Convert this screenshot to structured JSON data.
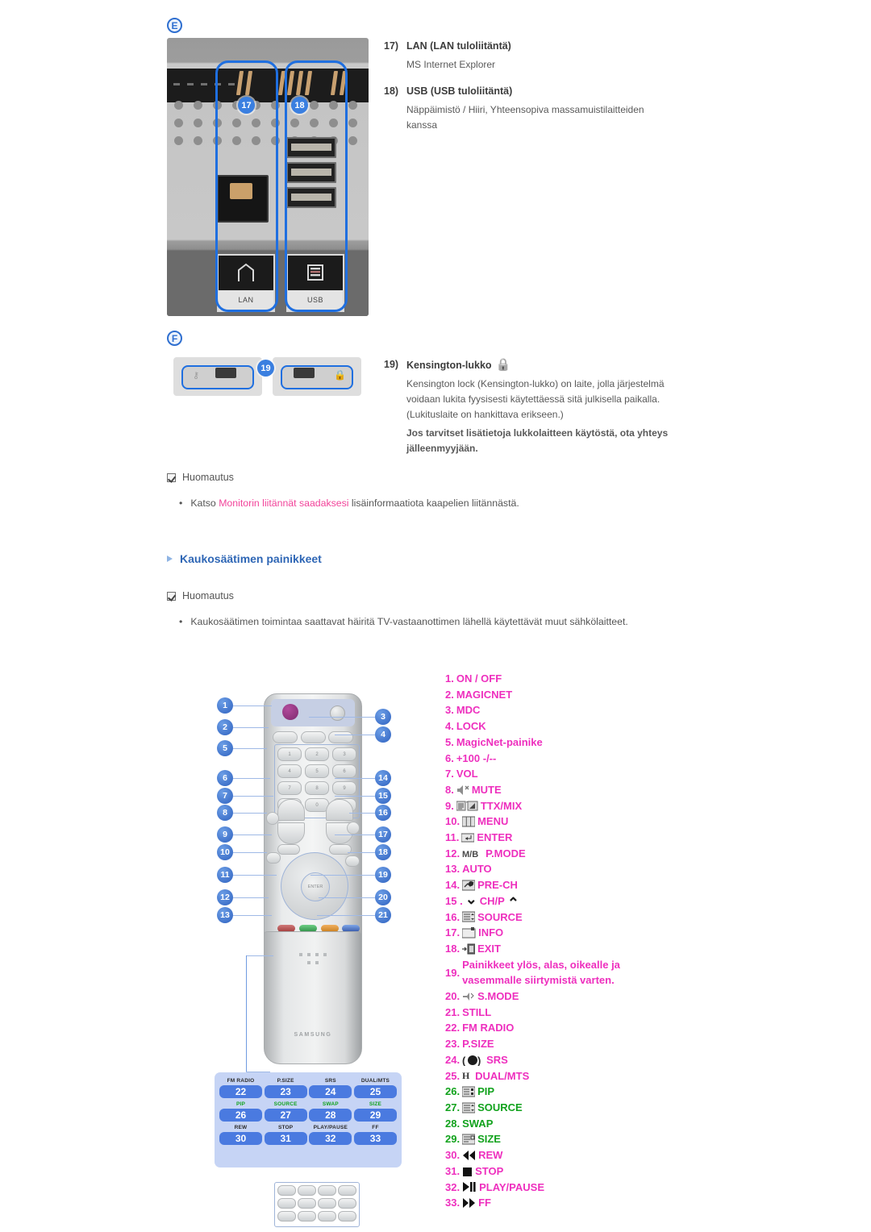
{
  "sections": {
    "E": {
      "badge": "E",
      "photo_labels": {
        "lan": "LAN",
        "usb": "USB"
      },
      "callouts": [
        "17",
        "18"
      ]
    },
    "F": {
      "badge": "F",
      "callouts": [
        "19"
      ]
    }
  },
  "connectors": [
    {
      "num": "17)",
      "title": "LAN (LAN tuloliitäntä)",
      "desc": "MS Internet Explorer"
    },
    {
      "num": "18)",
      "title": "USB (USB tuloliitäntä)",
      "desc": "Näppäimistö / Hiiri, Yhteensopiva massamuistilaitteiden kanssa"
    },
    {
      "num": "19)",
      "title": "Kensington-lukko",
      "icon": "padlock-icon",
      "desc": "Kensington lock (Kensington-lukko) on laite, jolla järjestelmä voidaan lukita fyysisesti käytettäessä sitä julkisella paikalla. (Lukituslaite on hankittava erikseen.)",
      "desc_bold": "Jos tarvitset lisätietoja lukkolaitteen käytöstä, ota yhteys jälleenmyyjään."
    }
  ],
  "notes": [
    {
      "head": "Huomautus",
      "bullet_pre": "Katso ",
      "bullet_link": "Monitorin liitännät saadaksesi",
      "bullet_post": " lisäinformaatiota kaapelien liitännästä."
    },
    {
      "head": "Huomautus",
      "bullet_pre": "Kaukosäätimen toimintaa saattavat häiritä TV-vastaanottimen lähellä käytettävät muut sähkölaitteet.",
      "bullet_link": "",
      "bullet_post": ""
    }
  ],
  "remote_heading": "Kaukosäätimen painikkeet",
  "remote_callouts_left": [
    "1",
    "2",
    "5",
    "6",
    "7",
    "8",
    "9",
    "10",
    "11",
    "12",
    "13"
  ],
  "remote_callouts_right": [
    "3",
    "4",
    "14",
    "15",
    "16",
    "17",
    "18",
    "19",
    "20",
    "21"
  ],
  "legend_grid": [
    [
      {
        "label": "FM RADIO",
        "num": "22",
        "color": "dark"
      },
      {
        "label": "P.SIZE",
        "num": "23",
        "color": "dark"
      },
      {
        "label": "SRS",
        "num": "24",
        "color": "dark"
      },
      {
        "label": "DUAL/MTS",
        "num": "25",
        "color": "dark"
      }
    ],
    [
      {
        "label": "PIP",
        "num": "26",
        "color": "green"
      },
      {
        "label": "SOURCE",
        "num": "27",
        "color": "green"
      },
      {
        "label": "SWAP",
        "num": "28",
        "color": "green"
      },
      {
        "label": "SIZE",
        "num": "29",
        "color": "green"
      }
    ],
    [
      {
        "label": "REW",
        "num": "30",
        "color": "dark"
      },
      {
        "label": "STOP",
        "num": "31",
        "color": "dark"
      },
      {
        "label": "PLAY/PAUSE",
        "num": "32",
        "color": "dark"
      },
      {
        "label": "FF",
        "num": "33",
        "color": "dark"
      }
    ]
  ],
  "button_list": [
    {
      "num": "1.",
      "label": "ON / OFF",
      "color": "pink",
      "icon": ""
    },
    {
      "num": "2.",
      "label": "MAGICNET",
      "color": "pink",
      "icon": ""
    },
    {
      "num": "3.",
      "label": "MDC",
      "color": "pink",
      "icon": ""
    },
    {
      "num": "4.",
      "label": "LOCK",
      "color": "pink",
      "icon": ""
    },
    {
      "num": "5.",
      "label": "MagicNet-painike",
      "color": "pink",
      "icon": ""
    },
    {
      "num": "6.",
      "label": "+100 -/--",
      "color": "pink",
      "icon": ""
    },
    {
      "num": "7.",
      "label": "VOL",
      "color": "pink",
      "icon": ""
    },
    {
      "num": "8.",
      "label": "MUTE",
      "color": "pink",
      "icon": "mute-icon"
    },
    {
      "num": "9.",
      "label": "TTX/MIX",
      "color": "pink",
      "icon": "teletext-mix-icon"
    },
    {
      "num": "10.",
      "label": "MENU",
      "color": "pink",
      "icon": "menu-icon"
    },
    {
      "num": "11.",
      "label": "ENTER",
      "color": "pink",
      "icon": "enter-icon"
    },
    {
      "num": "12.",
      "label": "P.MODE",
      "color": "pink",
      "icon": "mb-icon"
    },
    {
      "num": "13.",
      "label": "AUTO",
      "color": "pink",
      "icon": ""
    },
    {
      "num": "14.",
      "label": "PRE-CH",
      "color": "pink",
      "icon": "prech-icon"
    },
    {
      "num": "15 .",
      "label": "CH/P",
      "color": "pink",
      "icon": "chp-arrows-icon"
    },
    {
      "num": "16.",
      "label": "SOURCE",
      "color": "pink",
      "icon": "source-icon"
    },
    {
      "num": "17.",
      "label": "INFO",
      "color": "pink",
      "icon": "info-icon"
    },
    {
      "num": "18.",
      "label": "EXIT",
      "color": "pink",
      "icon": "exit-icon"
    },
    {
      "num": "19.",
      "label": "Painikkeet ylös, alas, oikealle ja vasemmalle siirtymistä varten.",
      "color": "pink",
      "icon": ""
    },
    {
      "num": "20.",
      "label": "S.MODE",
      "color": "pink",
      "icon": "smode-icon"
    },
    {
      "num": "21.",
      "label": "STILL",
      "color": "pink",
      "icon": ""
    },
    {
      "num": "22.",
      "label": "FM RADIO",
      "color": "pink",
      "icon": ""
    },
    {
      "num": "23.",
      "label": "P.SIZE",
      "color": "pink",
      "icon": ""
    },
    {
      "num": "24.",
      "label": "SRS",
      "color": "pink",
      "icon": "srs-icon"
    },
    {
      "num": "25.",
      "label": "DUAL/MTS",
      "color": "pink",
      "icon": "dual-mts-icon"
    },
    {
      "num": "26.",
      "label": "PIP",
      "color": "green",
      "icon": "pip-icon"
    },
    {
      "num": "27.",
      "label": "SOURCE",
      "color": "green",
      "icon": "source-icon"
    },
    {
      "num": "28.",
      "label": "SWAP",
      "color": "green",
      "icon": ""
    },
    {
      "num": "29.",
      "label": "SIZE",
      "color": "green",
      "icon": "size-icon"
    },
    {
      "num": "30.",
      "label": "REW",
      "color": "pink",
      "icon": "rewind-icon"
    },
    {
      "num": "31.",
      "label": "STOP",
      "color": "pink",
      "icon": "stop-icon"
    },
    {
      "num": "32.",
      "label": "PLAY/PAUSE",
      "color": "pink",
      "icon": "play-pause-icon"
    },
    {
      "num": "33.",
      "label": "FF",
      "color": "pink",
      "icon": "fast-forward-icon"
    }
  ],
  "colors": {
    "pink": "#ee2fbe",
    "green": "#11a21c",
    "heading_blue": "#2e66b5",
    "link_pink": "#f2439a",
    "callout_blue": "#2f62c0"
  }
}
